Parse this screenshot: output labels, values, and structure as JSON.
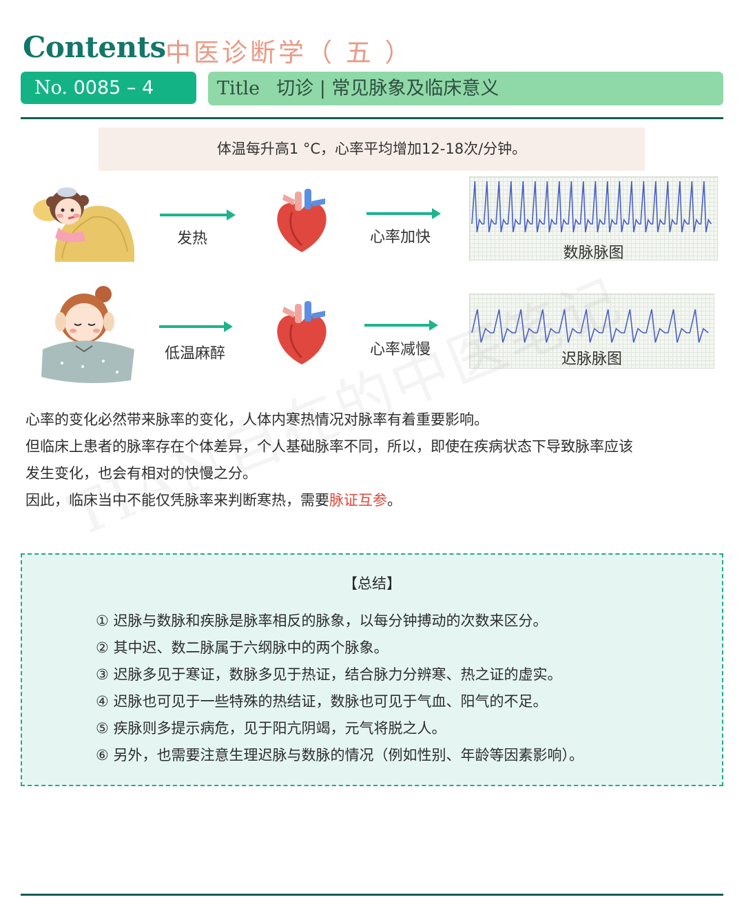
{
  "header": {
    "contents_word": "Contents",
    "subject": "中医诊断学（ 五 ）",
    "no_prefix": "No.",
    "no_value": "0085 – 4",
    "title_label": "Title",
    "title_text": "切诊 | 常见脉象及临床意义"
  },
  "callout": "体温每升高1 °C，心率平均增加12-18次/分钟。",
  "flow_rows": [
    {
      "label_a": "发热",
      "label_b": "心率加快",
      "ecg_label": "数脉脉图"
    },
    {
      "label_a": "低温麻醉",
      "label_b": "心率减慢",
      "ecg_label": "迟脉脉图"
    }
  ],
  "paragraphs": {
    "p1": "心率的变化必然带来脉率的变化，人体内寒热情况对脉率有着重要影响。",
    "p2a": "但临床上患者的脉率存在个体差异，个人基础脉率不同，所以，即使在疾病状态下导致脉率应该",
    "p2b": "发生变化，也会有相对的快慢之分。",
    "p3_prefix": "因此，临床当中不能仅凭脉率来判断寒热，需要",
    "p3_highlight": "脉证互参",
    "p3_suffix": "。"
  },
  "watermark": "TIAN自在的中医笔记",
  "summary": {
    "title": "【总结】",
    "items": [
      "① 迟脉与数脉和疾脉是脉率相反的脉象，以每分钟搏动的次数来区分。",
      "② 其中迟、数二脉属于六纲脉中的两个脉象。",
      "③ 迟脉多见于寒证，数脉多见于热证，结合脉力分辨寒、热之证的虚实。",
      "④ 迟脉也可见于一些特殊的热结证，数脉也可见于气血、阳气的不足。",
      "⑤ 疾脉则多提示病危，见于阳亢阴竭，元气将脱之人。",
      "⑥ 另外，也需要注意生理迟脉与数脉的情况（例如性别、年龄等因素影响）。"
    ]
  },
  "colors": {
    "brand_teal": "#13766a",
    "subject_pink": "#e99a86",
    "badge_green": "#14b386",
    "title_bar_green": "#8fd9a8",
    "arrow_green": "#1cb58b",
    "ecg_blue": "#4a5fc4",
    "highlight_red": "#e0483a",
    "summary_bg": "#e5f6f2"
  },
  "icons": [
    "sick-girl-illustration",
    "heart-icon",
    "sleeping-girl-illustration"
  ]
}
